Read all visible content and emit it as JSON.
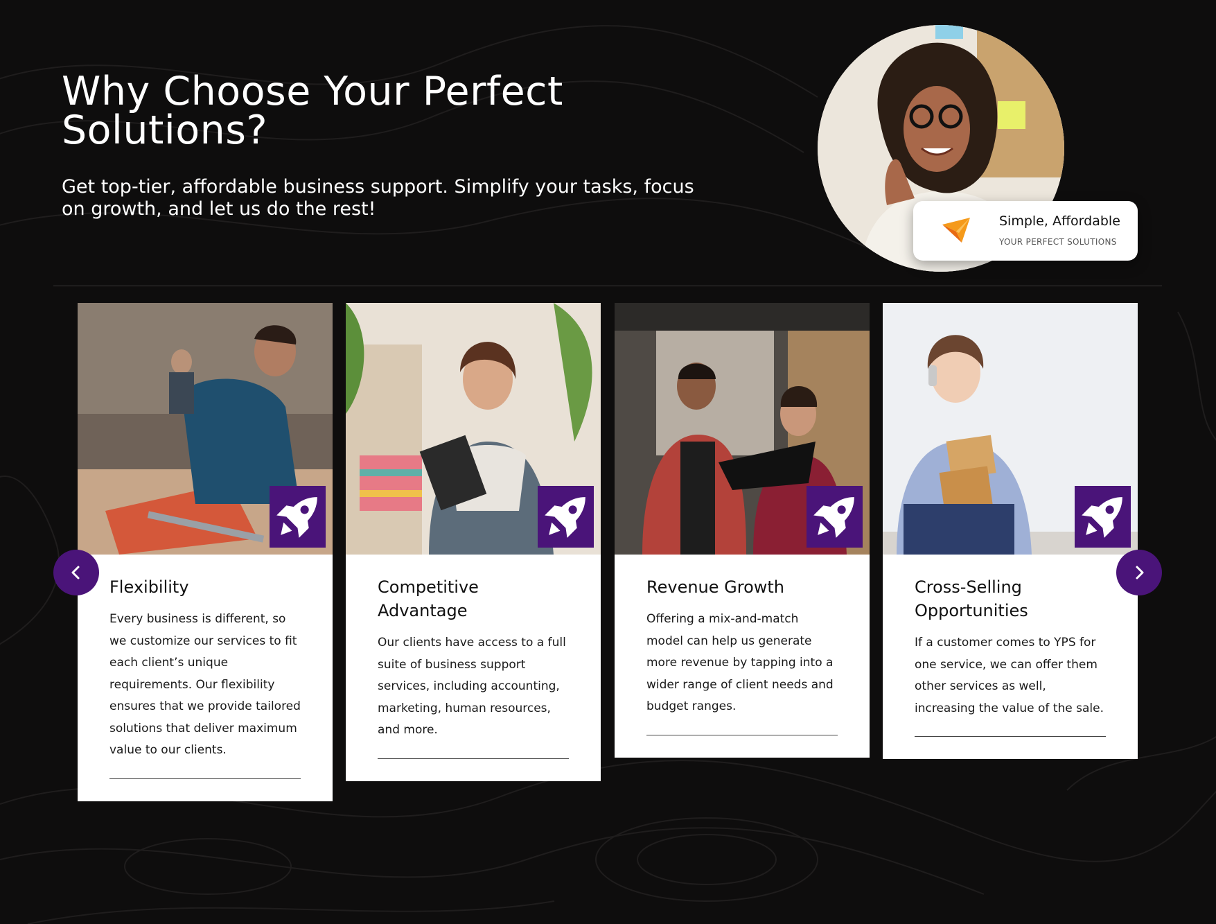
{
  "hero": {
    "title": "Why Choose Your Perfect Solutions?",
    "subtitle": "Get top-tier, affordable business support. Simplify your tasks, focus on growth, and let us do the rest!"
  },
  "badge": {
    "title": "Simple, Affordable",
    "subtitle": "YOUR PERFECT SOLUTIONS",
    "logo_icon": "paper-plane-logo-icon"
  },
  "colors": {
    "background": "#0e0d0d",
    "accent_purple": "#4a1479",
    "card_bg": "#ffffff",
    "logo_orange": "#f59a1b"
  },
  "cards": [
    {
      "title": "Flexibility",
      "text": "Every business is different, so we customize our services to fit each client’s unique requirements. Our flexibility ensures that we provide tailored solutions that deliver maximum value to our clients.",
      "icon": "rocket-icon"
    },
    {
      "title": "Competitive Advantage",
      "text": "Our clients have access to a full suite of business support services, including accounting, marketing, human resources, and more.",
      "icon": "rocket-icon"
    },
    {
      "title": "Revenue Growth",
      "text": "Offering a mix-and-match model can help us generate more revenue by tapping into a wider range of client needs and budget ranges.",
      "icon": "rocket-icon"
    },
    {
      "title": "Cross-Selling Opportunities",
      "text": "If a customer comes to YPS for one service, we can offer them other services as well, increasing the value of the sale.",
      "icon": "rocket-icon"
    }
  ],
  "carousel": {
    "prev_icon": "chevron-left-icon",
    "next_icon": "chevron-right-icon"
  }
}
